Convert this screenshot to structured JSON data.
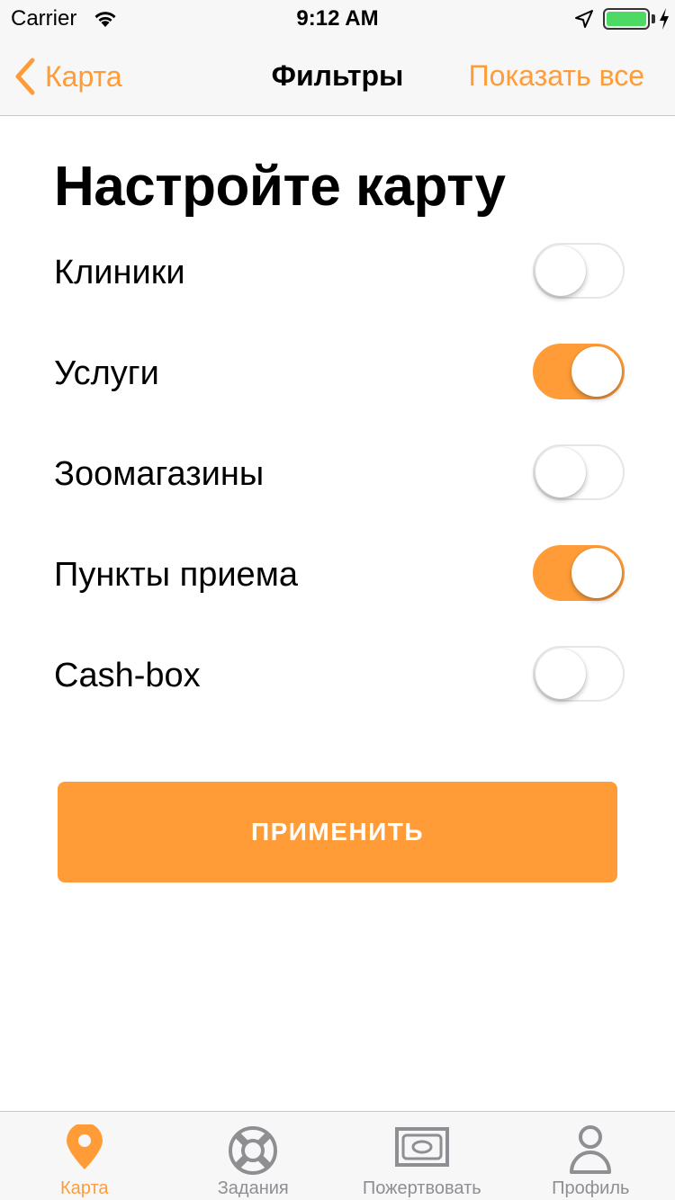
{
  "status_bar": {
    "carrier": "Carrier",
    "time": "9:12 AM",
    "battery_color": "#4cd964"
  },
  "nav": {
    "back_label": "Карта",
    "title": "Фильтры",
    "right_action": "Показать все",
    "accent_color": "#ff9c38"
  },
  "main": {
    "heading": "Настройте карту",
    "filters": [
      {
        "label": "Клиники",
        "enabled": false
      },
      {
        "label": "Услуги",
        "enabled": true
      },
      {
        "label": "Зоомагазины",
        "enabled": false
      },
      {
        "label": "Пункты приема",
        "enabled": true
      },
      {
        "label": "Cash-box",
        "enabled": false
      }
    ],
    "apply_label": "ПРИМЕНИТЬ"
  },
  "tab_bar": {
    "tabs": [
      {
        "label": "Карта",
        "icon": "map-pin-icon",
        "active": true
      },
      {
        "label": "Задания",
        "icon": "lifebuoy-icon",
        "active": false
      },
      {
        "label": "Пожертвовать",
        "icon": "banknote-icon",
        "active": false
      },
      {
        "label": "Профиль",
        "icon": "person-icon",
        "active": false
      }
    ]
  }
}
